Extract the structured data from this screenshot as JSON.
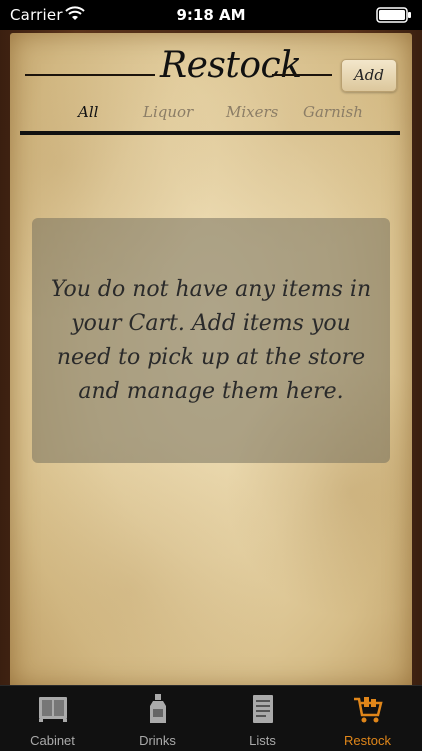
{
  "status_bar": {
    "carrier": "Carrier",
    "time": "9:18 AM"
  },
  "header": {
    "title": "Restock",
    "add_label": "Add"
  },
  "filter_tabs": [
    {
      "label": "All",
      "active": true
    },
    {
      "label": "Liquor",
      "active": false
    },
    {
      "label": "Mixers",
      "active": false
    },
    {
      "label": "Garnish",
      "active": false
    }
  ],
  "empty_state": {
    "message": "You do not have any items in your Cart. Add items you need to pick up at the store and manage them here."
  },
  "tab_bar": {
    "items": [
      {
        "label": "Cabinet",
        "icon": "cabinet-icon",
        "active": false
      },
      {
        "label": "Drinks",
        "icon": "bottle-icon",
        "active": false
      },
      {
        "label": "Lists",
        "icon": "list-icon",
        "active": false
      },
      {
        "label": "Restock",
        "icon": "cart-icon",
        "active": true
      }
    ]
  },
  "colors": {
    "active_tab": "#e0861a",
    "paper": "#e5d1a3",
    "wood": "#4a2a16"
  }
}
